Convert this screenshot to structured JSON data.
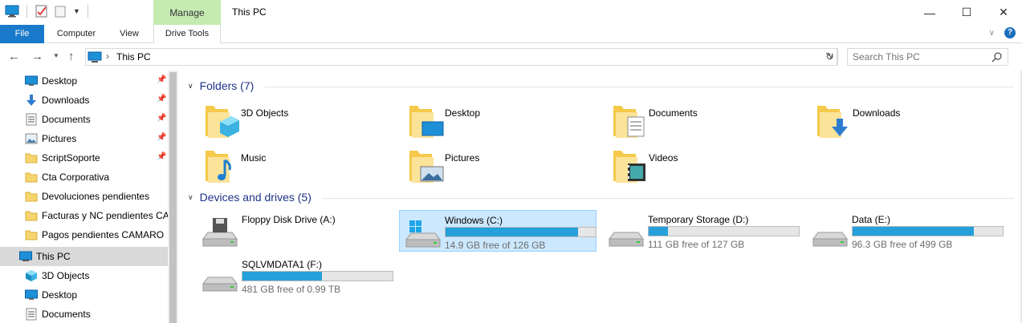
{
  "window": {
    "title": "This PC",
    "manage_tab": "Manage"
  },
  "ribbon": {
    "tabs": [
      "File",
      "Computer",
      "View",
      "Drive Tools"
    ]
  },
  "address": {
    "path": "This PC",
    "search_placeholder": "Search This PC"
  },
  "nav": {
    "quick_access": [
      {
        "label": "Desktop",
        "icon": "desktop-icon",
        "pinned": true
      },
      {
        "label": "Downloads",
        "icon": "downloads-icon",
        "pinned": true
      },
      {
        "label": "Documents",
        "icon": "documents-icon",
        "pinned": true
      },
      {
        "label": "Pictures",
        "icon": "pictures-icon",
        "pinned": true
      },
      {
        "label": "ScriptSoporte",
        "icon": "folder-icon",
        "pinned": true
      },
      {
        "label": "Cta Corporativa",
        "icon": "folder-icon",
        "pinned": false
      },
      {
        "label": "Devoluciones pendientes",
        "icon": "folder-icon",
        "pinned": false
      },
      {
        "label": "Facturas y NC pendientes CAMARO",
        "icon": "folder-icon",
        "pinned": false
      },
      {
        "label": "Pagos pendientes CAMARO",
        "icon": "folder-icon",
        "pinned": false
      }
    ],
    "this_pc": "This PC",
    "this_pc_children": [
      {
        "label": "3D Objects",
        "icon": "3d-objects-icon"
      },
      {
        "label": "Desktop",
        "icon": "desktop-icon"
      },
      {
        "label": "Documents",
        "icon": "documents-icon"
      }
    ]
  },
  "folders": {
    "heading": "Folders (7)",
    "items": [
      "3D Objects",
      "Desktop",
      "Documents",
      "Downloads",
      "Music",
      "Pictures",
      "Videos"
    ]
  },
  "drives": {
    "heading": "Devices and drives (5)",
    "items": [
      {
        "name": "Floppy Disk Drive (A:)",
        "free": "",
        "used_fraction": null,
        "selected": false
      },
      {
        "name": "Windows (C:)",
        "free": "14.9 GB free of 126 GB",
        "used_fraction": 0.88,
        "selected": true
      },
      {
        "name": "Temporary Storage (D:)",
        "free": "111 GB free of 127 GB",
        "used_fraction": 0.13,
        "selected": false
      },
      {
        "name": "Data (E:)",
        "free": "96.3 GB free of 499 GB",
        "used_fraction": 0.81,
        "selected": false
      },
      {
        "name": "SQLVMDATA1 (F:)",
        "free": "481 GB free of 0.99 TB",
        "used_fraction": 0.53,
        "selected": false
      }
    ]
  },
  "colors": {
    "accent": "#1979ca",
    "manage_tab": "#c5eab2",
    "group_heading": "#1e3287",
    "drive_bar": "#26a0da",
    "selection": "#cce8ff"
  }
}
